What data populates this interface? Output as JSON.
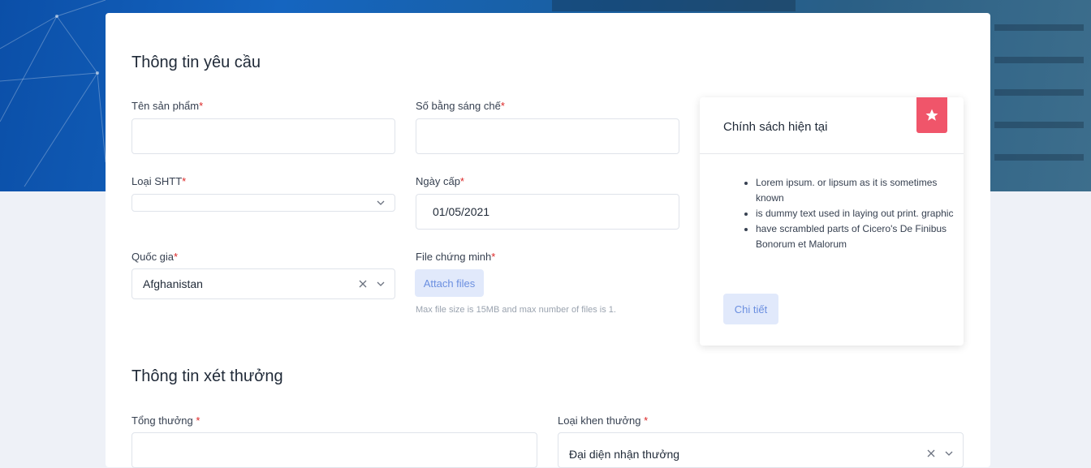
{
  "section1": {
    "title": "Thông tin yêu cầu",
    "product_name": {
      "label": "Tên sản phẩm",
      "value": ""
    },
    "patent_number": {
      "label": "Số bằng sáng chế",
      "value": ""
    },
    "ip_type": {
      "label": "Loại SHTT",
      "value": ""
    },
    "issue_date": {
      "label": "Ngày cấp",
      "value": "01/05/2021"
    },
    "country": {
      "label": "Quốc gia",
      "value": "Afghanistan"
    },
    "proof_file": {
      "label": "File chứng minh",
      "button": "Attach files",
      "hint": "Max file size is 15MB and max number of files is 1."
    },
    "required_mark": "*"
  },
  "policy": {
    "title": "Chính sách hiện tại",
    "items": [
      "Lorem ipsum. or lipsum as it is sometimes known",
      "is dummy text used in laying out print. graphic",
      "have scrambled parts of Cicero's De Finibus Bonorum et Malorum"
    ],
    "button": "Chi tiết",
    "badge_icon": "star-icon"
  },
  "section2": {
    "title": "Thông tin xét thưởng",
    "total_reward": {
      "label": "Tổng thưởng",
      "value": ""
    },
    "reward_type": {
      "label": "Loại khen thưởng",
      "value": "Đại diện nhận thưởng"
    }
  },
  "colors": {
    "accent": "#6b8fe0",
    "required": "#dc2626",
    "badge": "#f0556a",
    "annotation": "#b22222"
  }
}
